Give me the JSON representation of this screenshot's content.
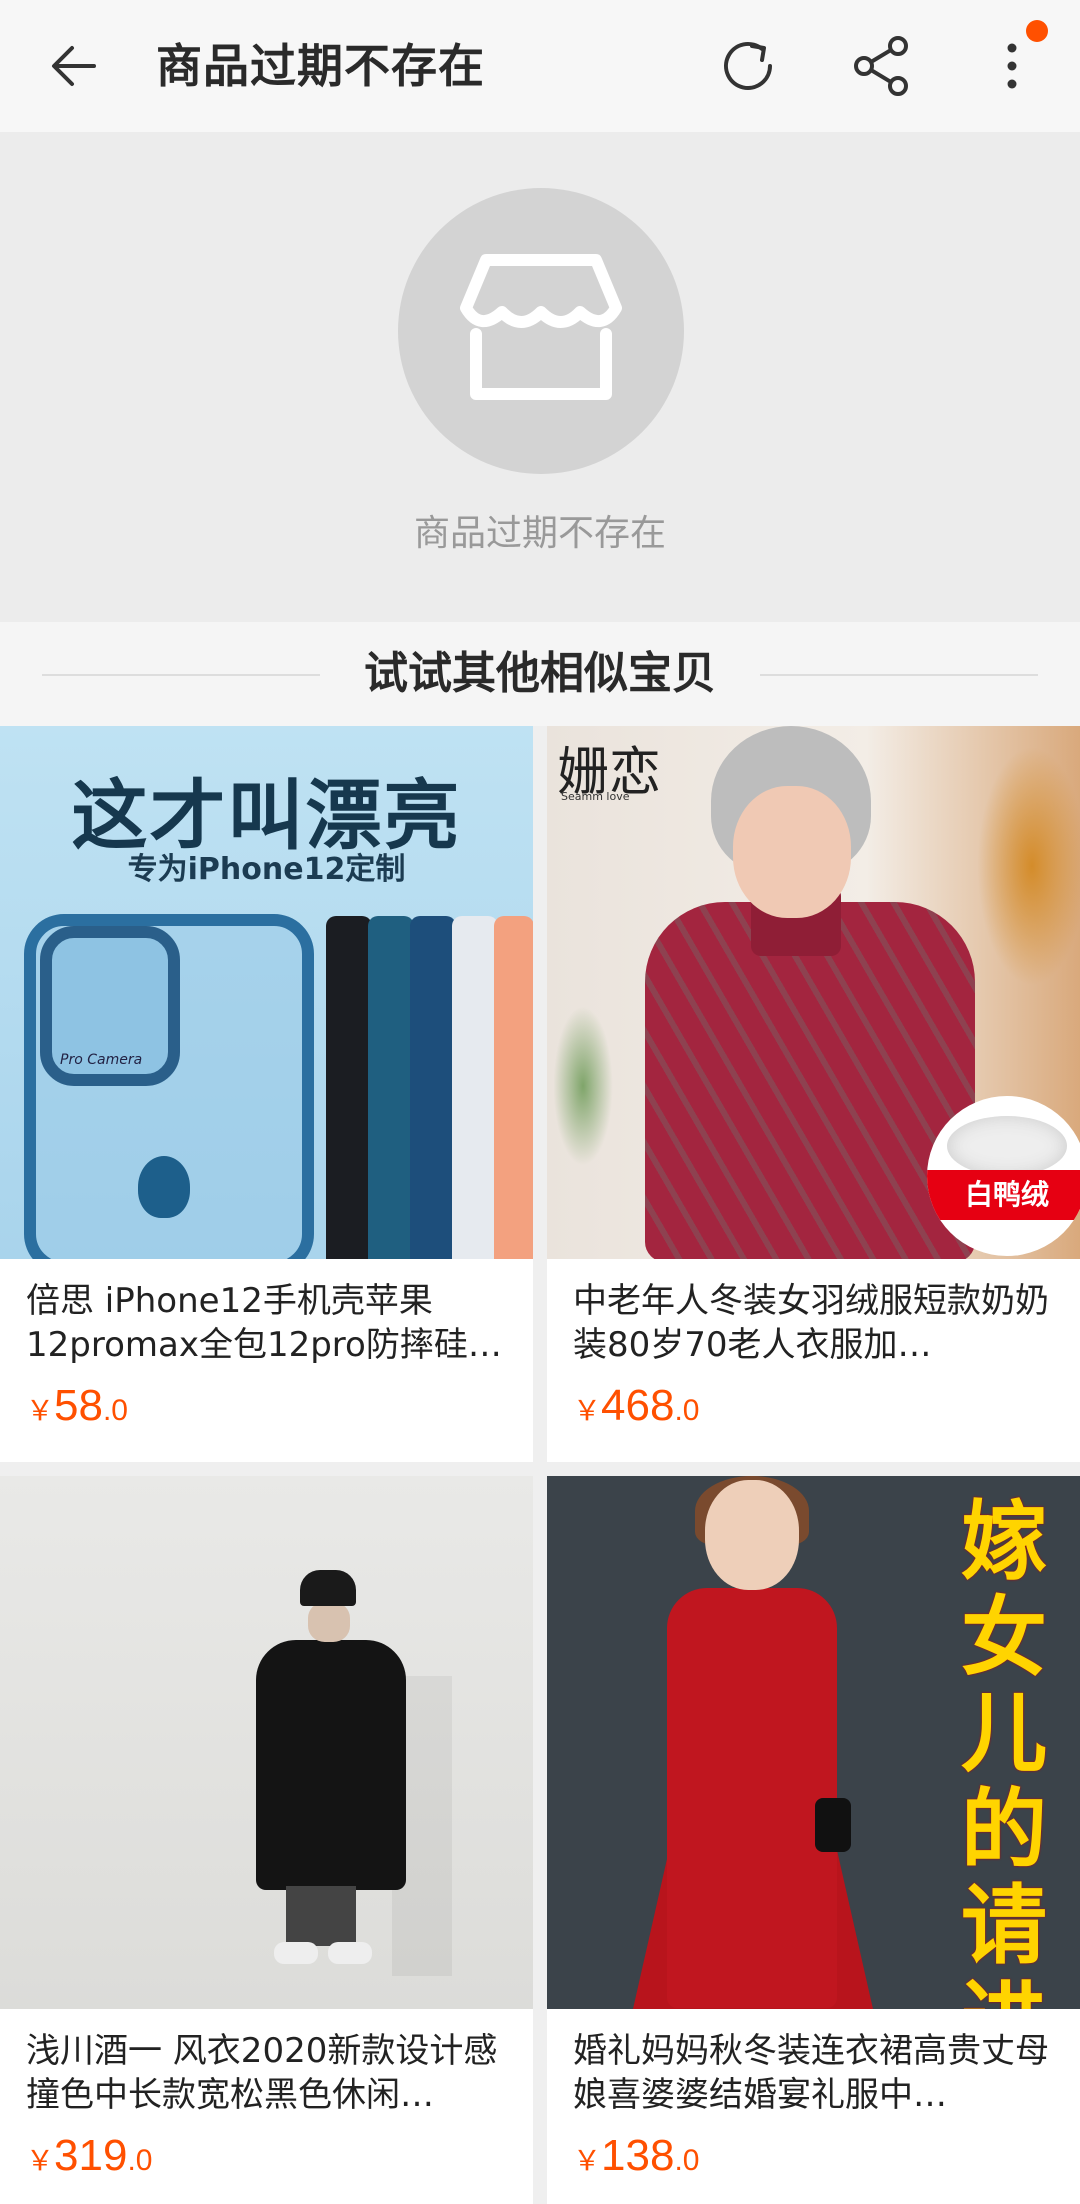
{
  "header": {
    "title": "商品过期不存在"
  },
  "empty_state": {
    "icon": "store-icon",
    "message": "商品过期不存在"
  },
  "section": {
    "title": "试试其他相似宝贝"
  },
  "products": [
    {
      "name": "倍思 iPhone12手机壳苹果12promax全包12pro防摔硅胶…",
      "currency": "￥",
      "price_int": "58",
      "price_dec": ".0",
      "image": {
        "headline": "这才叫漂亮",
        "subline": "专为iPhone12定制",
        "camera_label": "Pro Camera"
      }
    },
    {
      "name": "中老年人冬装女羽绒服短款奶奶装80岁70老人衣服加…",
      "currency": "￥",
      "price_int": "468",
      "price_dec": ".0",
      "image": {
        "brand": "姗恋",
        "brand_sub": "Seamm love",
        "badge": "白鸭绒"
      }
    },
    {
      "name": "浅川酒一 风衣2020新款设计感撞色中长款宽松黑色休闲…",
      "currency": "￥",
      "price_int": "319",
      "price_dec": ".0",
      "image": {}
    },
    {
      "name": "婚礼妈妈秋冬装连衣裙高贵丈母娘喜婆婆结婚宴礼服中…",
      "currency": "￥",
      "price_int": "138",
      "price_dec": ".0",
      "image": {
        "overlay": "嫁女儿的请进"
      }
    }
  ],
  "colors": {
    "accent": "#ff5000",
    "background": "#efefef"
  }
}
